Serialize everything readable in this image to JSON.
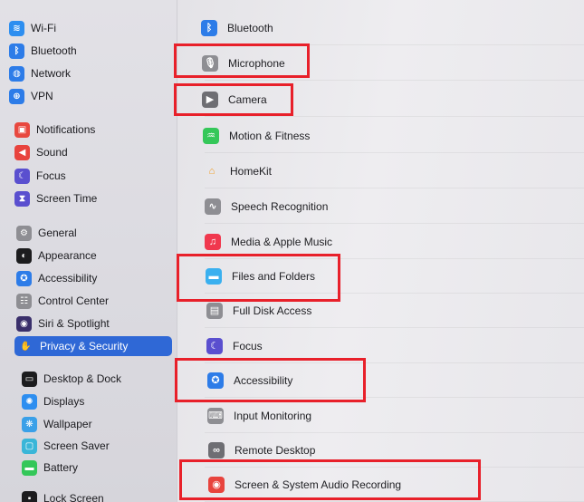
{
  "sidebar": {
    "items": [
      {
        "label": "Wi-Fi",
        "icon": "wifi-icon",
        "color": "#2d8ef0",
        "glyph": "≋"
      },
      {
        "label": "Bluetooth",
        "icon": "bluetooth-icon",
        "color": "#2d7ce8",
        "glyph": "ᛒ"
      },
      {
        "label": "Network",
        "icon": "globe-icon",
        "color": "#2d7ce8",
        "glyph": "◍"
      },
      {
        "label": "VPN",
        "icon": "vpn-icon",
        "color": "#2d7ce8",
        "glyph": "⊕"
      },
      {
        "label": "Notifications",
        "icon": "bell-icon",
        "color": "#e8483f",
        "glyph": "▣"
      },
      {
        "label": "Sound",
        "icon": "speaker-icon",
        "color": "#e8433d",
        "glyph": "◀"
      },
      {
        "label": "Focus",
        "icon": "moon-icon",
        "color": "#5a4fcf",
        "glyph": "☾"
      },
      {
        "label": "Screen Time",
        "icon": "hourglass-icon",
        "color": "#5a4fcf",
        "glyph": "⧗"
      },
      {
        "label": "General",
        "icon": "gear-icon",
        "color": "#8e8e93",
        "glyph": "⚙"
      },
      {
        "label": "Appearance",
        "icon": "appearance-icon",
        "color": "#1c1c1e",
        "glyph": "◐"
      },
      {
        "label": "Accessibility",
        "icon": "accessibility-icon",
        "color": "#2d7ce8",
        "glyph": "✪"
      },
      {
        "label": "Control Center",
        "icon": "control-center-icon",
        "color": "#8e8e93",
        "glyph": "☷"
      },
      {
        "label": "Siri & Spotlight",
        "icon": "siri-icon",
        "color": "#3a2f6b",
        "glyph": "◉"
      },
      {
        "label": "Privacy & Security",
        "icon": "hand-icon",
        "color": "#2f68d6",
        "glyph": "✋"
      },
      {
        "label": "Desktop & Dock",
        "icon": "dock-icon",
        "color": "#1c1c1e",
        "glyph": "▭"
      },
      {
        "label": "Displays",
        "icon": "sun-icon",
        "color": "#2d8ef0",
        "glyph": "✺"
      },
      {
        "label": "Wallpaper",
        "icon": "wallpaper-icon",
        "color": "#3aa0e8",
        "glyph": "❋"
      },
      {
        "label": "Screen Saver",
        "icon": "screen-saver-icon",
        "color": "#3ab6d8",
        "glyph": "▢"
      },
      {
        "label": "Battery",
        "icon": "battery-icon",
        "color": "#34c759",
        "glyph": "▬"
      },
      {
        "label": "Lock Screen",
        "icon": "lock-icon",
        "color": "#1c1c1e",
        "glyph": "▪"
      }
    ]
  },
  "main": {
    "rows": [
      {
        "label": "Bluetooth",
        "icon": "bluetooth-icon",
        "color": "#2d7ce8",
        "glyph": "ᛒ"
      },
      {
        "label": "Microphone",
        "icon": "microphone-icon",
        "color": "#8e8e93",
        "glyph": "🎙"
      },
      {
        "label": "Camera",
        "icon": "camera-icon",
        "color": "#6e6e73",
        "glyph": "▶"
      },
      {
        "label": "Motion & Fitness",
        "icon": "motion-icon",
        "color": "#34c759",
        "glyph": "♒"
      },
      {
        "label": "HomeKit",
        "icon": "home-icon",
        "color": "#f2f2f7",
        "glyph": "⌂"
      },
      {
        "label": "Speech Recognition",
        "icon": "waveform-icon",
        "color": "#8e8e93",
        "glyph": "∿"
      },
      {
        "label": "Media & Apple Music",
        "icon": "music-icon",
        "color": "#f0384e",
        "glyph": "♫"
      },
      {
        "label": "Files and Folders",
        "icon": "folder-icon",
        "color": "#3ab0ef",
        "glyph": "▬"
      },
      {
        "label": "Full Disk Access",
        "icon": "disk-icon",
        "color": "#8e8e93",
        "glyph": "▤"
      },
      {
        "label": "Focus",
        "icon": "moon-icon",
        "color": "#5a4fcf",
        "glyph": "☾"
      },
      {
        "label": "Accessibility",
        "icon": "accessibility-icon",
        "color": "#2d7ce8",
        "glyph": "✪"
      },
      {
        "label": "Input Monitoring",
        "icon": "keyboard-icon",
        "color": "#8e8e93",
        "glyph": "⌨"
      },
      {
        "label": "Remote Desktop",
        "icon": "binoculars-icon",
        "color": "#6e6e73",
        "glyph": "∞"
      },
      {
        "label": "Screen & System Audio Recording",
        "icon": "record-icon",
        "color": "#e8433d",
        "glyph": "◉"
      }
    ],
    "chevron": "›"
  },
  "highlight_color": "#e8202a"
}
